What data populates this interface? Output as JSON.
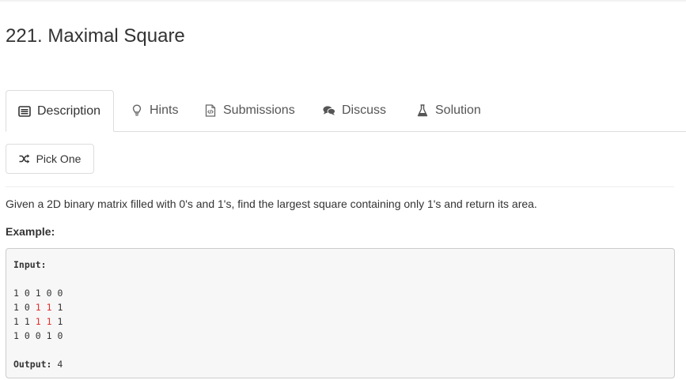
{
  "problem": {
    "title": "221. Maximal Square"
  },
  "tabs": [
    {
      "label": "Description",
      "icon": "description-icon",
      "active": true
    },
    {
      "label": "Hints",
      "icon": "lightbulb-icon",
      "active": false
    },
    {
      "label": "Submissions",
      "icon": "code-file-icon",
      "active": false
    },
    {
      "label": "Discuss",
      "icon": "comments-icon",
      "active": false
    },
    {
      "label": "Solution",
      "icon": "flask-icon",
      "active": false
    }
  ],
  "pick_one": {
    "label": "Pick One",
    "icon": "shuffle-icon"
  },
  "description": {
    "text": "Given a 2D binary matrix filled with 0's and 1's, find the largest square containing only 1's and return its area."
  },
  "example": {
    "label": "Example:",
    "input_label": "Input:",
    "matrix": [
      [
        {
          "v": "1"
        },
        {
          "v": "0"
        },
        {
          "v": "1"
        },
        {
          "v": "0"
        },
        {
          "v": "0"
        }
      ],
      [
        {
          "v": "1"
        },
        {
          "v": "0"
        },
        {
          "v": "1",
          "hl": true
        },
        {
          "v": "1",
          "hl": true
        },
        {
          "v": "1"
        }
      ],
      [
        {
          "v": "1"
        },
        {
          "v": "1"
        },
        {
          "v": "1",
          "hl": true
        },
        {
          "v": "1",
          "hl": true
        },
        {
          "v": "1"
        }
      ],
      [
        {
          "v": "1"
        },
        {
          "v": "0"
        },
        {
          "v": "0"
        },
        {
          "v": "1"
        },
        {
          "v": "0"
        }
      ]
    ],
    "output_label": "Output:",
    "output_value": "4"
  },
  "colors": {
    "highlight": "#e03030",
    "code_background": "#f7f7f7",
    "border": "#dddddd"
  }
}
